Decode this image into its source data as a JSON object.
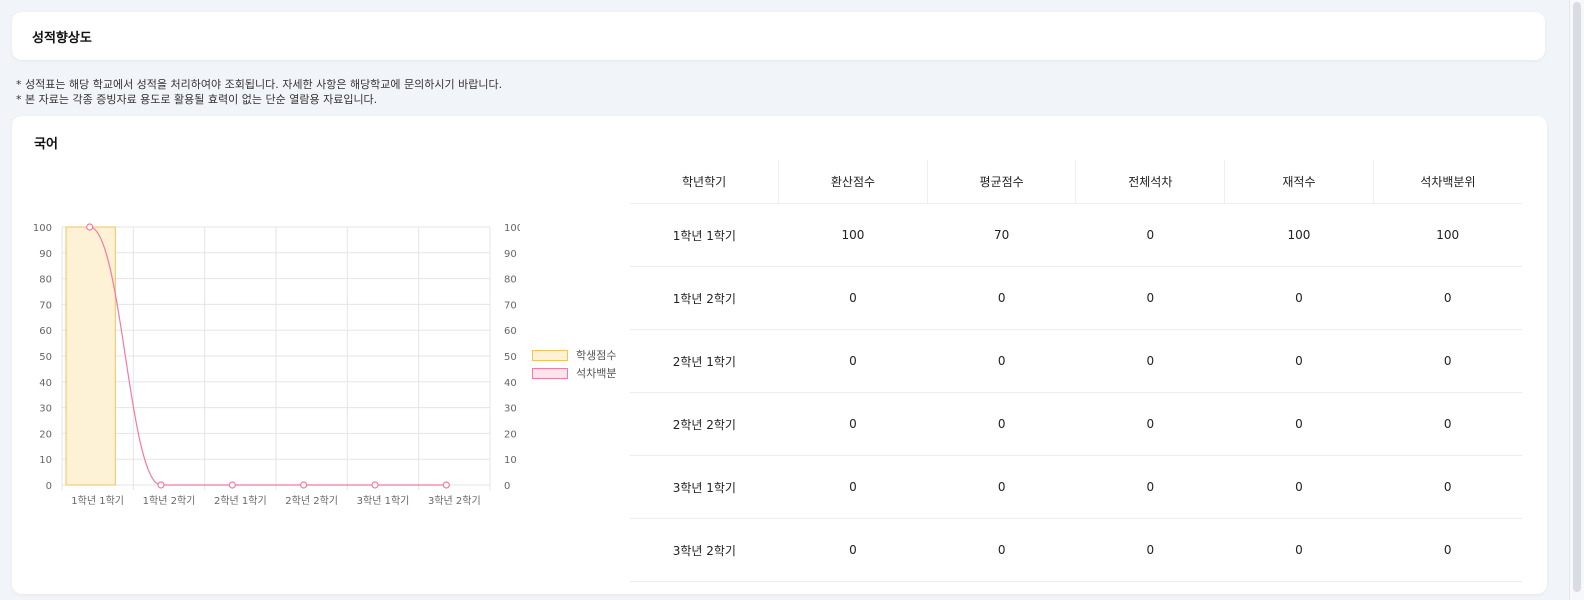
{
  "page": {
    "title": "성적향상도",
    "notes": [
      "* 성적표는 해당 학교에서 성적을 처리하여야 조회됩니다. 자세한 사항은 해당학교에 문의하시기 바랍니다.",
      "* 본 자료는 각종 증빙자료 용도로 활용될 효력이 없는 단순 열람용 자료입니다."
    ],
    "subject": "국어"
  },
  "colors": {
    "bar_fill": "#fdf1d6",
    "bar_stroke": "#f4c25a",
    "line_stroke": "#f47aa0",
    "line_fill": "#fde4ec",
    "grid": "#e3e5e9",
    "tick": "#666666"
  },
  "chart_data": {
    "type": "bar",
    "categories": [
      "1학년 1학기",
      "1학년 2학기",
      "2학년 1학기",
      "2학년 2학기",
      "3학년 1학기",
      "3학년 2학기"
    ],
    "series": [
      {
        "name": "학생점수",
        "type": "bar",
        "values": [
          100,
          0,
          0,
          0,
          0,
          0
        ]
      },
      {
        "name": "석차백분",
        "type": "line",
        "values": [
          100,
          0,
          0,
          0,
          0,
          0
        ]
      }
    ],
    "ylim": [
      0,
      100
    ],
    "y2lim": [
      0,
      100
    ],
    "yticks": [
      0,
      10,
      20,
      30,
      40,
      50,
      60,
      70,
      80,
      90,
      100
    ],
    "grid": true,
    "legend": "right"
  },
  "table": {
    "headers": [
      "학년학기",
      "환산점수",
      "평균점수",
      "전체석차",
      "재적수",
      "석차백분위"
    ],
    "rows": [
      [
        "1학년 1학기",
        "100",
        "70",
        "0",
        "100",
        "100"
      ],
      [
        "1학년 2학기",
        "0",
        "0",
        "0",
        "0",
        "0"
      ],
      [
        "2학년 1학기",
        "0",
        "0",
        "0",
        "0",
        "0"
      ],
      [
        "2학년 2학기",
        "0",
        "0",
        "0",
        "0",
        "0"
      ],
      [
        "3학년 1학기",
        "0",
        "0",
        "0",
        "0",
        "0"
      ],
      [
        "3학년 2학기",
        "0",
        "0",
        "0",
        "0",
        "0"
      ]
    ]
  }
}
